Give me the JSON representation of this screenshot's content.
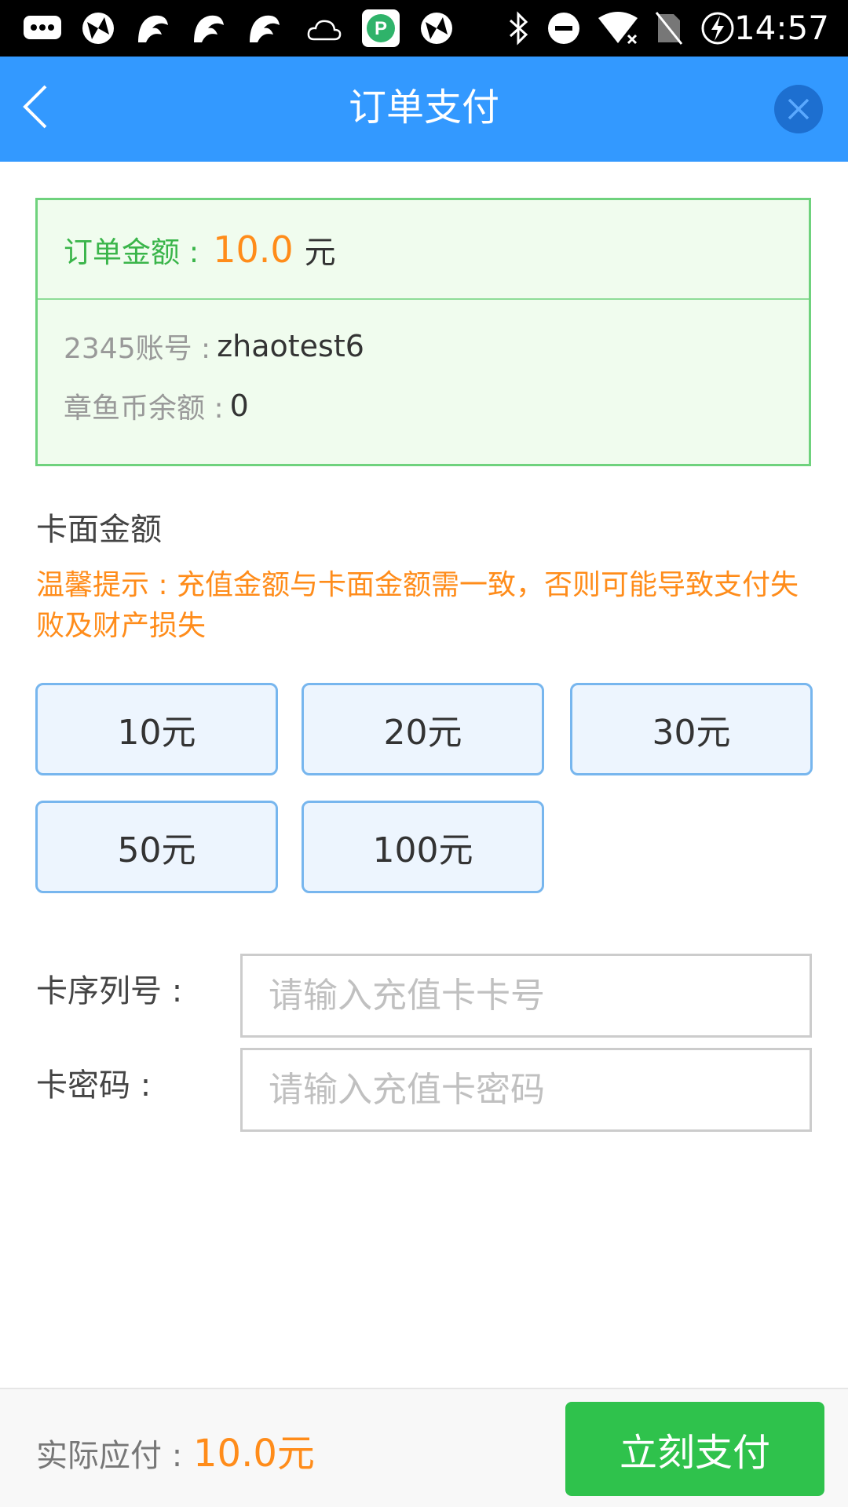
{
  "status_bar": {
    "time": "14:57",
    "icons": [
      "message-icon",
      "app-icon",
      "uc-browser-icon",
      "uc-browser-icon",
      "uc-browser-icon",
      "weather-icon",
      "p-app-icon",
      "app-icon",
      "bluetooth-icon",
      "do-not-disturb-icon",
      "wifi-icon",
      "no-sim-icon",
      "battery-charging-icon"
    ]
  },
  "header": {
    "title": "订单支付"
  },
  "order": {
    "label": "订单金额 :",
    "amount": "10.0",
    "unit": "元"
  },
  "account": {
    "account_label": "2345账号 :",
    "account_value": "zhaotest6",
    "balance_label": "章鱼币余额 :",
    "balance_value": "0"
  },
  "card_amount": {
    "title": "卡面金额",
    "tip": "温馨提示 : 充值金额与卡面金额需一致，否则可能导致支付失败及财产损失",
    "options": [
      "10元",
      "20元",
      "30元",
      "50元",
      "100元"
    ]
  },
  "form": {
    "serial_label": "卡序列号 :",
    "serial_placeholder": "请输入充值卡卡号",
    "password_label": "卡密码 :",
    "password_placeholder": "请输入充值卡密码"
  },
  "footer": {
    "pay_label": "实际应付 :",
    "pay_amount": "10.0元",
    "pay_button": "立刻支付"
  },
  "colors": {
    "header_bg": "#3399ff",
    "accent_orange": "#ff8c1a",
    "success_green": "#2fc24c",
    "info_box_border": "#6fd27d"
  }
}
